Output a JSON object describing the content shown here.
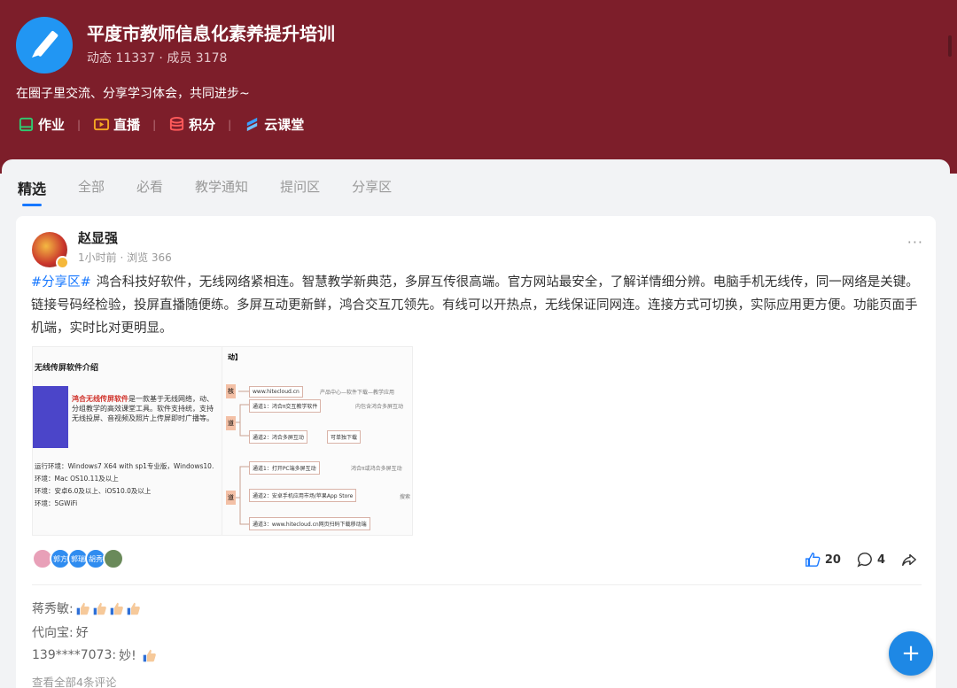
{
  "header": {
    "title": "平度市教师信息化素养提升培训",
    "stats": "动态 11337 · 成员 3178",
    "description": "在圈子里交流、分享学习体会，共同进步~",
    "quick_links": [
      {
        "label": "作业",
        "icon": "homework-icon",
        "color": "#2ecc71"
      },
      {
        "label": "直播",
        "icon": "live-icon",
        "color": "#f5a623"
      },
      {
        "label": "积分",
        "icon": "points-icon",
        "color": "#ff5a5a"
      },
      {
        "label": "云课堂",
        "icon": "cloud-class-icon",
        "color": "#3aa0ff"
      }
    ],
    "bg_color": "#7d1e2a"
  },
  "tabs": [
    "精选",
    "全部",
    "必看",
    "教学通知",
    "提问区",
    "分享区"
  ],
  "active_tab": "精选",
  "post": {
    "author": "赵显强",
    "meta": "1小时前 · 浏览 366",
    "more": "···",
    "tag": "#分享区#",
    "text": "鸿合科技好软件，无线网络紧相连。智慧教学新典范，多屏互传很高端。官方网站最安全，了解详情细分辨。电脑手机无线传，同一网络是关键。链接号码经检验，投屏直播随便练。多屏互动更新鲜，鸿合交互兀领先。有线可以开热点，无线保证同网连。连接方式可切换，实际应用更方便。功能页面手机端，实时比对更明显。",
    "image": {
      "left_title": "无线传屏软件介绍",
      "left_highlight": "鸿合无线传屏软件",
      "left_desc": "是一款基于无线网络，动、分组教学的高效课堂工具。软件支持统，支持无线投屏、音视频及照片上传屏即时广播等。",
      "left_specs": [
        "运行环境：Windows7 X64 with sp1专业版，Windows10.",
        "环境：Mac OS10.11及以上",
        "环境：安卓6.0及以上、iOS10.0及以上",
        "环境：5GWiFi"
      ],
      "right_header": "动】",
      "nodes": [
        "www.hitecloud.cn",
        "产品中心—软件下载—教学应用",
        "通道1：鸿合π交互教学软件",
        "内包含鸿合多屏互动",
        "通道2：鸿合多屏互动",
        "可单独下载",
        "通道1：打开PC端多屏互动",
        "鸿合π或鸿合多屏互动",
        "通道2：安卓手机应用市场/苹果App Store",
        "搜索",
        "通道3：www.hitecloud.cn网页扫码下载移动端"
      ],
      "root_labels": [
        "核",
        "道",
        "道"
      ]
    },
    "likers": [
      {
        "label": "",
        "color": "#e8a0b8"
      },
      {
        "label": "郭方",
        "color": "#2f8cf0"
      },
      {
        "label": "郭瑞",
        "color": "#2f8cf0"
      },
      {
        "label": "胡秀",
        "color": "#2f8cf0"
      },
      {
        "label": "",
        "color": "#6a8a5a"
      }
    ],
    "likes": "20",
    "comments_count": "4",
    "comments": [
      {
        "user": "蒋秀敏:",
        "text": "",
        "thumbs": 4
      },
      {
        "user": "代向宝:",
        "text": "好",
        "thumbs": 0
      },
      {
        "user": "139****7073:",
        "text": "妙!",
        "thumbs": 1
      }
    ],
    "see_all": "查看全部4条评论"
  },
  "fab_label": "+",
  "accent_color": "#1677ff"
}
